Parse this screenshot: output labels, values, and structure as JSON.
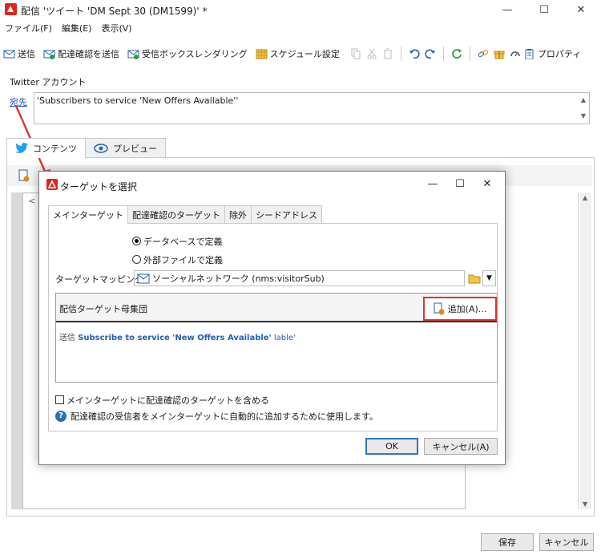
{
  "window": {
    "title": "配信 'ツイート 'DM Sept 30 (DM1599)' *",
    "minimize_glyph": "—",
    "maximize_glyph": "☐",
    "close_glyph": "✕"
  },
  "menu": [
    "ファイル(F)",
    "編集(E)",
    "表示(V)"
  ],
  "toolbar": {
    "send": "送信",
    "send_proof": "配達確認を送信",
    "inbox_rendering": "受信ボックスレンダリング",
    "schedule": "スケジュール設定",
    "properties": "プロパティ"
  },
  "twitter_account_label": "Twitter アカウント",
  "to_link": "宛先",
  "recipient_text": "'Subscribers to service 'New Offers Available''",
  "tabs": {
    "content": "コンテンツ",
    "preview": "プレビュー"
  },
  "editor_snippet": "<",
  "bottom_buttons": {
    "save": "保存",
    "cancel": "キャンセル"
  },
  "dialog": {
    "title": "ターゲットを選択",
    "tabs": [
      "メインターゲット",
      "配達確認のターゲット",
      "除外",
      "シードアドレス"
    ],
    "radio_db": "データベースで定義",
    "radio_file": "外部ファイルで定義",
    "mapping_label": "ターゲットマッピング:",
    "mapping_value": "ソーシャルネットワーク (nms:visitorSub)",
    "population_label": "配信ターゲット母集団",
    "add_button": "追加(A)...",
    "condition_prefix": "送信",
    "condition_link": "Subscribe to service 'New Offers Available'",
    "condition_suffix": "lable'",
    "checkbox_label": "メインターゲットに配達確認のターゲットを含める",
    "help_text": "配達確認の受信者をメインターゲットに自動的に追加するために使用します。",
    "ok": "OK",
    "cancel": "キャンセル(A)"
  },
  "colors": {
    "accent": "#e0241b",
    "link": "#1a4fd0",
    "highlight_border": "#d9382b",
    "twitter": "#1da1f2"
  }
}
